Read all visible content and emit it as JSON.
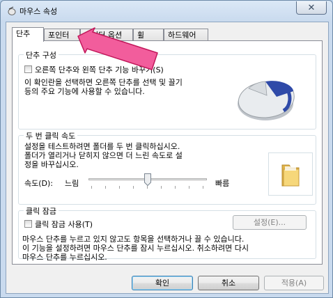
{
  "window": {
    "title": "마우스 속성",
    "close_label": "✕"
  },
  "tabs": [
    {
      "label": "단추",
      "active": true
    },
    {
      "label": "포인터"
    },
    {
      "label": "포인터 옵션"
    },
    {
      "label": "휠"
    },
    {
      "label": "하드웨어"
    }
  ],
  "button_config": {
    "title": "단추 구성",
    "swap_label": "오른쪽 단추와 왼쪽 단추 기능 바꾸기(S)",
    "swap_checked": false,
    "description_line1": "이 확인란을 선택하면 오른쪽 단추를 선택 및 끌기",
    "description_line2": "등의 주요 기능에 사용할 수 있습니다."
  },
  "double_click": {
    "title": "두 번 클릭 속도",
    "description_line1": "설정을 테스트하려면 폴더를 두 번 클릭하십시오.",
    "description_line2": "폴더가 열리거나 닫히지 않으면 더 느린 속도로 설",
    "description_line3": "정을 바꾸십시오.",
    "speed_label": "속도(D):",
    "slow_label": "느림",
    "fast_label": "빠름",
    "speed_value": 0.5
  },
  "click_lock": {
    "title": "클릭 잠금",
    "enable_label": "클릭 잠금 사용(T)",
    "enabled": false,
    "settings_label": "설정(E)...",
    "description_line1": "마우스 단추를 누르고 있지 않고도 항목을 선택하거나 끌 수 있습니다.",
    "description_line2": "이 기능을 설정하려면 마우스 단추를 잠시 누르십시오. 취소하려면 다시",
    "description_line3": "마우스 단추를 누르십시오."
  },
  "footer": {
    "ok_label": "확인",
    "cancel_label": "취소",
    "apply_label": "적용(A)"
  },
  "colors": {
    "annotation_arrow": "#f25d9c",
    "window_frame": "#c9daee"
  }
}
